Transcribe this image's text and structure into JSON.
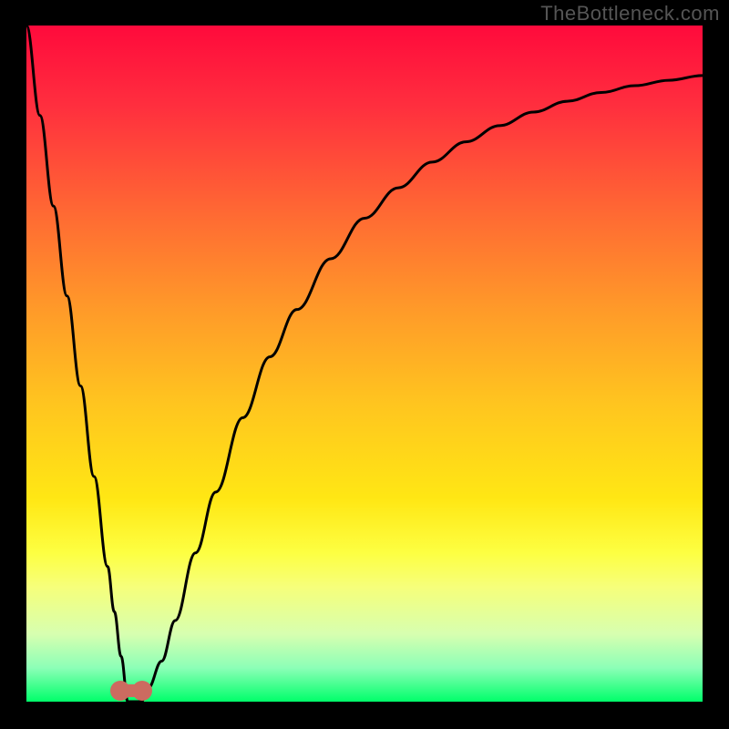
{
  "watermark": "TheBottleneck.com",
  "chart_data": {
    "type": "line",
    "title": "",
    "xlabel": "",
    "ylabel": "",
    "xlim": [
      0,
      100
    ],
    "ylim": [
      0,
      100
    ],
    "x": [
      0,
      2,
      4,
      6,
      8,
      10,
      12,
      13,
      14,
      15,
      16,
      17,
      18,
      20,
      22,
      25,
      28,
      32,
      36,
      40,
      45,
      50,
      55,
      60,
      65,
      70,
      75,
      80,
      85,
      90,
      95,
      100
    ],
    "values": [
      100,
      86.7,
      73.3,
      60,
      46.7,
      33.3,
      20,
      13.3,
      6.7,
      0,
      0,
      0,
      2,
      6,
      12,
      22,
      31,
      42,
      51,
      58,
      65.5,
      71.5,
      76,
      79.8,
      82.8,
      85.2,
      87.2,
      88.8,
      90.1,
      91.1,
      91.9,
      92.6
    ],
    "optimum_x": 15.5,
    "background_gradient": [
      "#ff0a3c",
      "#ff6a33",
      "#ffc51f",
      "#fdff42",
      "#00ff6a"
    ],
    "marker_color": "#cc6b60",
    "curve_color": "#000000"
  }
}
